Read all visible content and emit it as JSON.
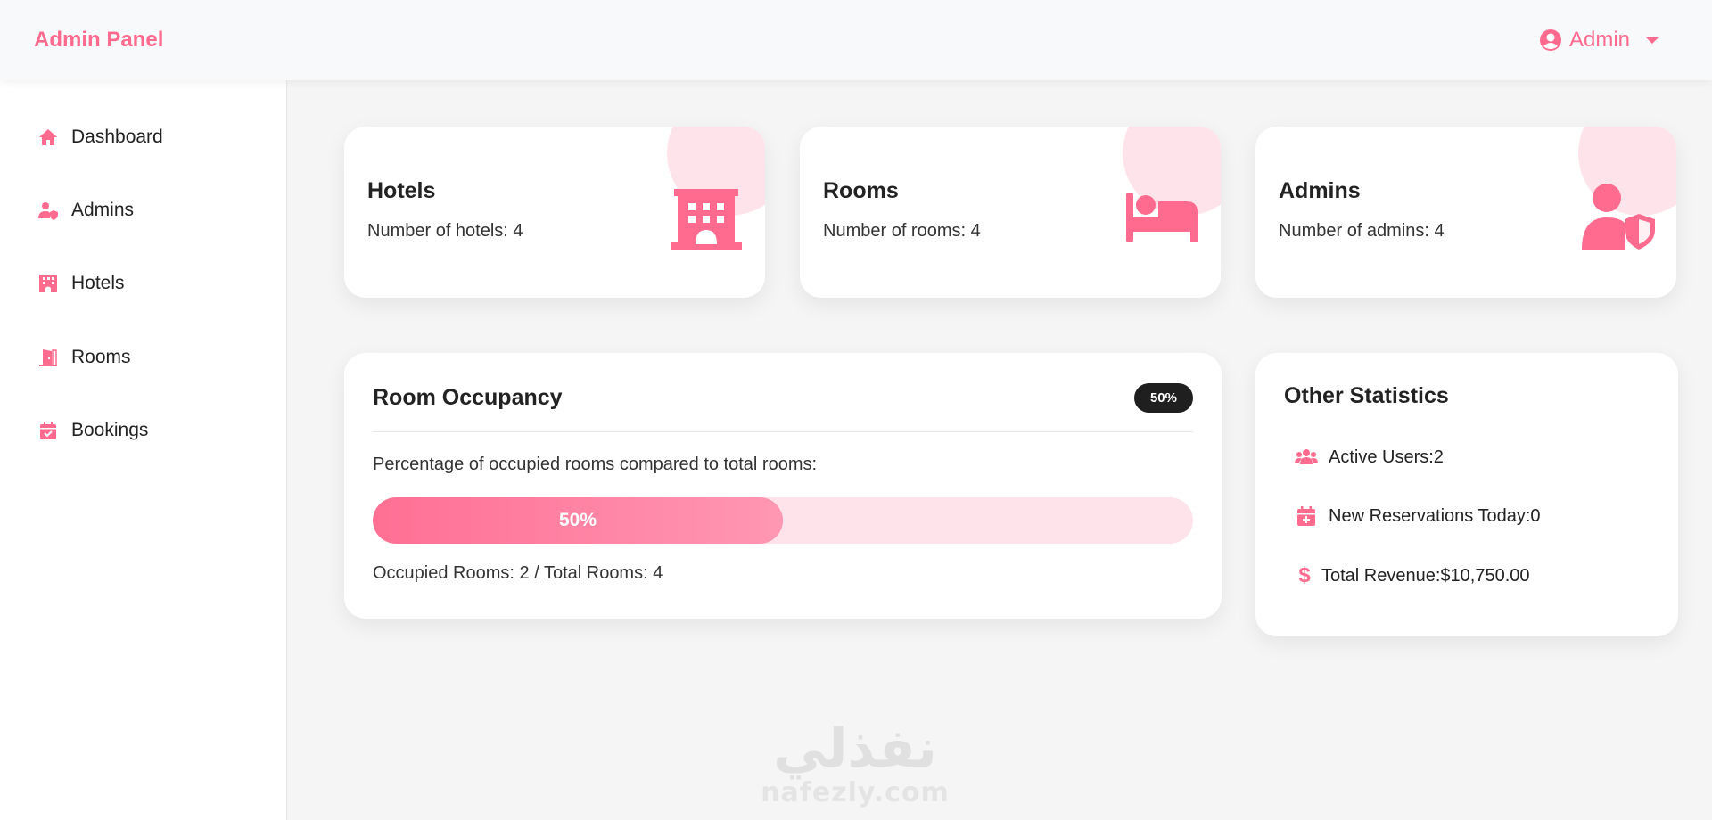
{
  "header": {
    "brand": "Admin Panel",
    "user_label": "Admin"
  },
  "sidebar": {
    "items": [
      {
        "label": "Dashboard",
        "icon": "home-icon"
      },
      {
        "label": "Admins",
        "icon": "user-shield-icon"
      },
      {
        "label": "Hotels",
        "icon": "hotel-icon"
      },
      {
        "label": "Rooms",
        "icon": "door-open-icon"
      },
      {
        "label": "Bookings",
        "icon": "calendar-check-icon"
      }
    ]
  },
  "stats": [
    {
      "title": "Hotels",
      "text": "Number of hotels: 4",
      "icon": "hotel-icon"
    },
    {
      "title": "Rooms",
      "text": "Number of rooms: 4",
      "icon": "bed-icon"
    },
    {
      "title": "Admins",
      "text": "Number of admins: 4",
      "icon": "user-shield-icon"
    }
  ],
  "occupancy": {
    "title": "Room Occupancy",
    "badge": "50%",
    "description": "Percentage of occupied rooms compared to total rooms:",
    "progress_label": "50%",
    "progress_percent": 50,
    "footer": "Occupied Rooms: 2 / Total Rooms: 4"
  },
  "other_stats": {
    "title": "Other Statistics",
    "items": [
      {
        "text": "Active Users:2",
        "icon": "users-icon"
      },
      {
        "text": "New Reservations Today:0",
        "icon": "calendar-plus-icon"
      },
      {
        "text": "Total Revenue:$10,750.00",
        "icon": "dollar-icon"
      }
    ]
  },
  "watermark": {
    "arabic": "نفذلي",
    "latin": "nafezly.com"
  },
  "colors": {
    "accent": "#ff6b8f",
    "accent_light": "#ffe3ea",
    "badge_bg": "#1f1f1f"
  }
}
